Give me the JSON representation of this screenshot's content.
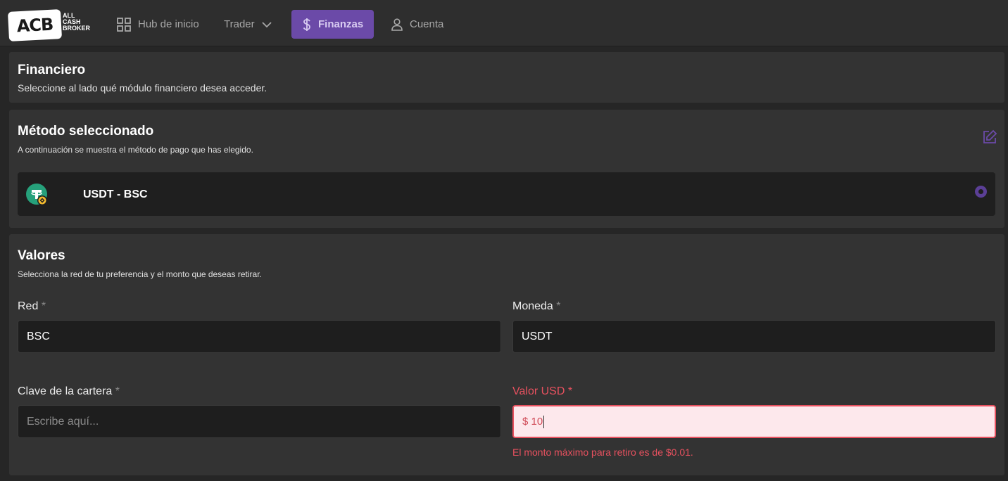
{
  "brand": {
    "logo_mark": "ACB",
    "logo_text": "ALL CASH BROKER"
  },
  "nav": {
    "items": [
      {
        "label": "Hub de inicio",
        "icon": "grid-icon"
      },
      {
        "label": "Trader",
        "icon": "chevron-down-icon"
      },
      {
        "label": "Finanzas",
        "icon": "dollar-icon",
        "active": true
      },
      {
        "label": "Cuenta",
        "icon": "user-icon"
      }
    ]
  },
  "header_card": {
    "title": "Financiero",
    "subtitle": "Seleccione al lado qué módulo financiero desea acceder."
  },
  "method_card": {
    "title": "Método seleccionado",
    "subtitle": "A continuación se muestra el método de pago que has elegido.",
    "method_name": "USDT - BSC"
  },
  "values_card": {
    "title": "Valores",
    "subtitle": "Selecciona la red de tu preferencia y el monto que deseas retirar.",
    "red": {
      "label": "Red",
      "required_mark": "*",
      "value": "BSC"
    },
    "moneda": {
      "label": "Moneda",
      "required_mark": "*",
      "value": "USDT"
    },
    "clave": {
      "label": "Clave de la cartera",
      "required_mark": "*",
      "placeholder": "Escribe aquí..."
    },
    "valor": {
      "label": "Valor USD",
      "required_mark": "*",
      "value": "$ 10"
    },
    "error_message": "El monto máximo para retiro es de $0.01."
  },
  "colors": {
    "accent": "#6b4aa8",
    "error": "#e8515f",
    "tether_green": "#26a17b",
    "bsc_yellow": "#f3ba2f"
  }
}
